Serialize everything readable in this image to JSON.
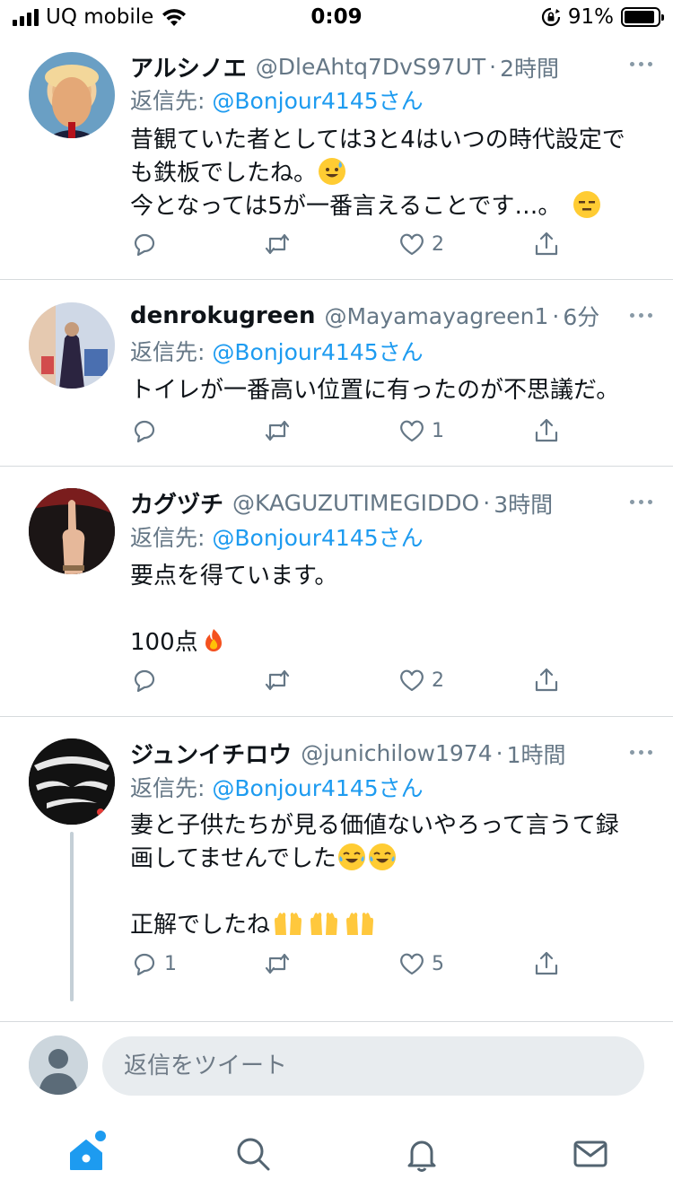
{
  "status_bar": {
    "carrier": "UQ mobile",
    "time": "0:09",
    "battery_percent": "91%",
    "battery_level": 0.91
  },
  "tweets": [
    {
      "display_name": "アルシノエ",
      "handle": "@DleAhtq7DvS97UT",
      "time": "2時間",
      "reply_prefix": "返信先: ",
      "reply_to": "@Bonjour4145さん",
      "lines": [
        "昔観ていた者としては3と4はいつの時代設定で",
        "も鉄板でしたね。",
        "今となっては5が一番言えることです…。"
      ],
      "emoji": [
        "sweat-smile-emoji",
        "expressionless-emoji"
      ],
      "reply_count": "",
      "retweet_count": "",
      "like_count": "2"
    },
    {
      "display_name": "denrokugreen",
      "handle": "@Mayamayagreen1",
      "time": "6分",
      "reply_prefix": "返信先: ",
      "reply_to": "@Bonjour4145さん",
      "lines": [
        "トイレが一番高い位置に有ったのが不思議だ。"
      ],
      "reply_count": "",
      "retweet_count": "",
      "like_count": "1"
    },
    {
      "display_name": "カグヅチ",
      "handle": "@KAGUZUTIMEGIDDO",
      "time": "3時間",
      "reply_prefix": "返信先: ",
      "reply_to": "@Bonjour4145さん",
      "lines": [
        "要点を得ています。",
        "",
        "100点"
      ],
      "emoji": [
        "fire-emoji"
      ],
      "reply_count": "",
      "retweet_count": "",
      "like_count": "2"
    },
    {
      "display_name": "ジュンイチロウ",
      "handle": "@junichilow1974",
      "time": "1時間",
      "reply_prefix": "返信先: ",
      "reply_to": "@Bonjour4145さん",
      "lines": [
        "妻と子供たちが見る価値ないやろって言うて録",
        "画してませんでした",
        "",
        "正解でしたね"
      ],
      "emoji": [
        "tears-of-joy-emoji",
        "raising-hands-emoji"
      ],
      "reply_count": "1",
      "retweet_count": "",
      "like_count": "5"
    }
  ],
  "composer": {
    "placeholder": "返信をツイート"
  },
  "tab_bar": {
    "items": [
      "home-icon",
      "search-icon",
      "bell-icon",
      "mail-icon"
    ]
  },
  "colors": {
    "accent": "#1d9bf0",
    "muted": "#657786",
    "divider": "#d6dadd"
  }
}
